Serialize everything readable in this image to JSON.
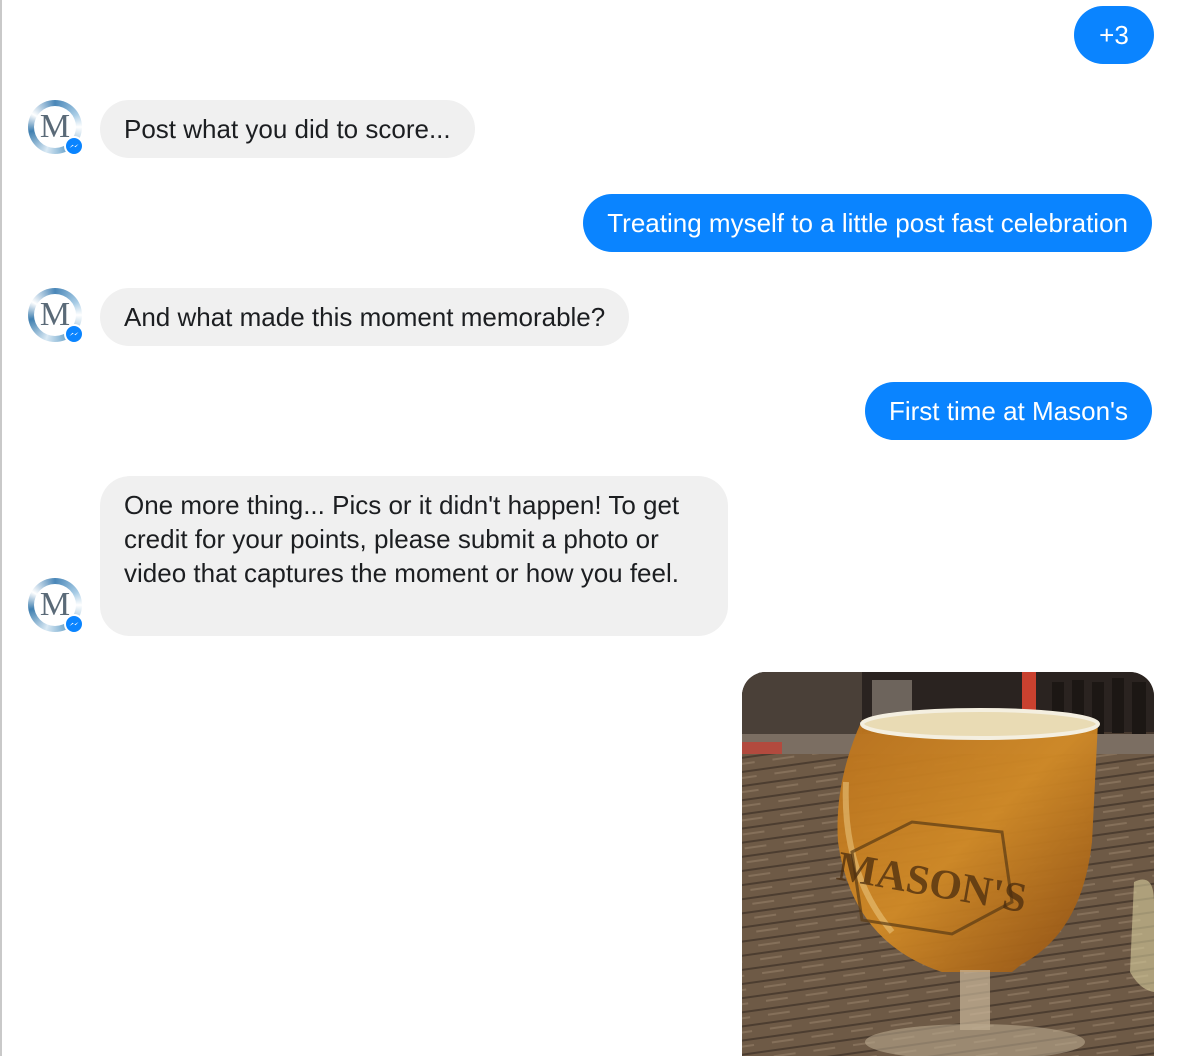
{
  "conversation": {
    "messages": [
      {
        "direction": "outgoing",
        "text": "+3"
      },
      {
        "direction": "incoming",
        "text": "Post what you did to score..."
      },
      {
        "direction": "outgoing",
        "text": "Treating myself to a little post fast celebration"
      },
      {
        "direction": "incoming",
        "text": "And what made this moment memorable?"
      },
      {
        "direction": "outgoing",
        "text": "First time at Mason's"
      },
      {
        "direction": "incoming",
        "text": "One more thing... Pics or it didn't happen! To get credit for your points, please submit a photo or video that captures the moment or how you feel."
      },
      {
        "direction": "outgoing",
        "type": "photo",
        "glass_logo_text": "MASON'S"
      }
    ],
    "avatar_letter": "M",
    "bot_avatar_icon": "m-logo-icon",
    "badge_icon": "messenger-icon"
  },
  "colors": {
    "outgoing_bubble": "#0a84ff",
    "incoming_bubble": "#f0f0f0",
    "badge": "#0a84ff"
  }
}
